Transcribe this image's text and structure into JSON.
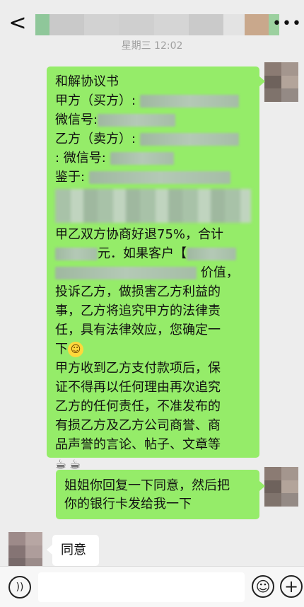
{
  "header": {
    "back_icon": "chevron-left-icon",
    "more_icon": "more-dots-icon",
    "back_label": "<",
    "more_label": "•••"
  },
  "timestamp": "星期三 12:02",
  "messages": {
    "agreement": {
      "lines": [
        "和解协议书",
        "甲方（买方）:",
        "微信号:",
        "乙方（卖方）:",
        ": 微信号:",
        "鉴于:",
        "甲乙双方协商好退75%，合计",
        "元．如果客户【",
        "价值，",
        "投诉乙方，做损害乙方利益的",
        "事，乙方将追究甲方的法律责",
        "任，具有法律效应，您确定一",
        "下",
        "甲方收到乙方支付款项后，保",
        "证不得再以任何理由再次追究",
        "乙方的任何责任，不准发布的",
        "有损乙方及乙方公司商誉、商",
        "品声誉的言论、帖子、文章等"
      ],
      "emoji_smile": "smile-emoji",
      "emoji_tea": "tea-cup-emoji"
    },
    "request": {
      "lines": [
        "姐姐你回复一下同意，然后把",
        "你的银行卡发给我一下"
      ]
    },
    "reply": {
      "text": "同意"
    }
  },
  "input_bar": {
    "voice_icon": "voice-icon",
    "emoji_icon": "emoji-icon",
    "plus_icon": "plus-icon",
    "input_value": ""
  }
}
